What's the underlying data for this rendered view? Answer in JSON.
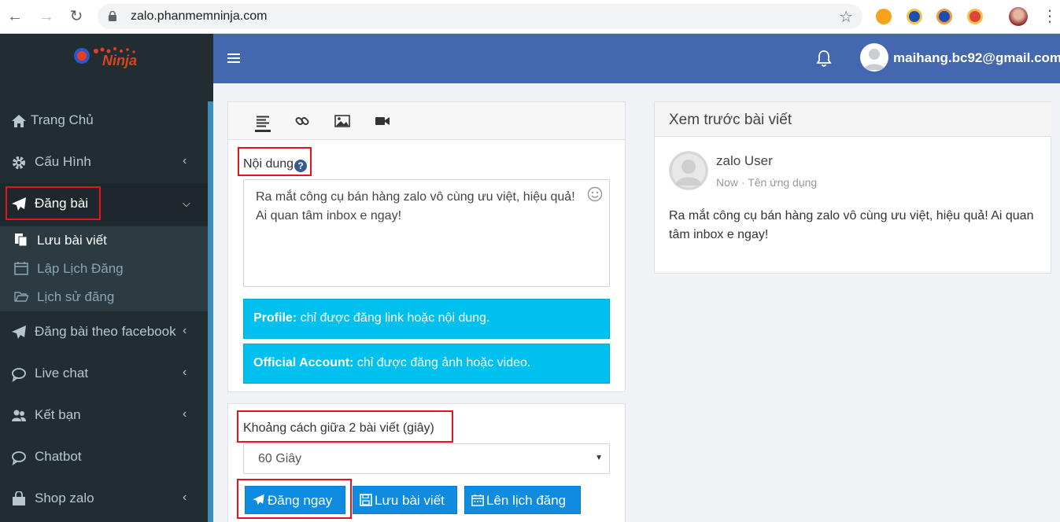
{
  "browser": {
    "url": "zalo.phanmemninja.com"
  },
  "logo": {
    "text": "Ninja"
  },
  "header": {
    "user_email": "maihang.bc92@gmail.com"
  },
  "sidebar": {
    "items": [
      {
        "label": "Trang Chủ",
        "icon": "home-icon"
      },
      {
        "label": "Cấu Hình",
        "icon": "gear-icon"
      },
      {
        "label": "Đăng bài",
        "icon": "paper-plane-icon"
      },
      {
        "label": "Đăng bài theo facebook",
        "icon": "paper-plane-icon"
      },
      {
        "label": "Live chat",
        "icon": "chat-icon"
      },
      {
        "label": "Kết bạn",
        "icon": "users-icon"
      },
      {
        "label": "Chatbot",
        "icon": "chat-icon"
      },
      {
        "label": "Shop zalo",
        "icon": "shop-icon"
      }
    ],
    "submenu": [
      {
        "label": "Lưu bài viết",
        "icon": "copy-icon"
      },
      {
        "label": "Lập Lịch Đăng",
        "icon": "calendar-icon"
      },
      {
        "label": "Lịch sử đăng",
        "icon": "folder-open-icon"
      }
    ]
  },
  "compose": {
    "content_label": "Nội dung",
    "help_glyph": "?",
    "content_text": "Ra mắt công cụ bán hàng zalo vô cùng ưu việt, hiệu quả! Ai quan tâm inbox e ngay!",
    "profile_title": "Profile:",
    "profile_note": " chỉ được đăng link hoặc nội dung.",
    "oa_title": "Official Account:",
    "oa_note": " chỉ được đăng ảnh hoặc video."
  },
  "interval": {
    "label": "Khoảng cách giữa 2 bài viết (giây)",
    "selected": "60 Giây"
  },
  "actions": {
    "post_now": "Đăng ngay",
    "save_post": "Lưu bài viết",
    "schedule": "Lên lịch đăng"
  },
  "preview": {
    "title": "Xem trước bài viết",
    "user_name": "zalo User",
    "meta": "Now · Tên ứng dụng",
    "text": "Ra mắt công cụ bán hàng zalo vô cùng ưu việt, hiệu quả! Ai quan tâm inbox e ngay!"
  },
  "colors": {
    "sidebar_bg": "#222d32",
    "header_bg": "#4468b0",
    "info_bg": "#00c0ef",
    "button_bg": "#0f8be0",
    "highlight": "#e3171b"
  }
}
